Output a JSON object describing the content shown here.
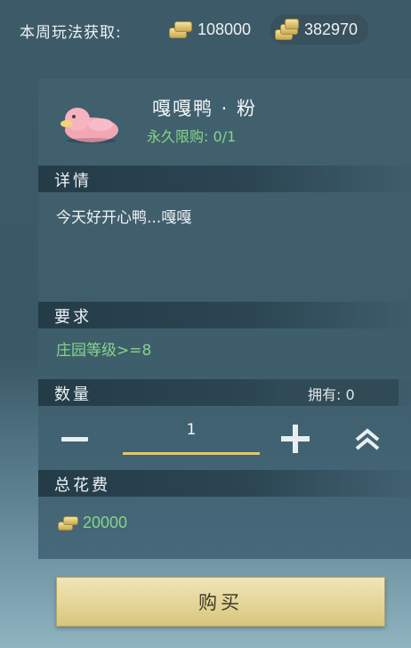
{
  "top": {
    "week_label": "本周玩法获取:",
    "currency_1": {
      "icon": "gold-ingot-icon",
      "value": "108000"
    },
    "currency_2": {
      "icon": "gold-ingot-stack-icon",
      "value": "382970"
    }
  },
  "item": {
    "icon": "pink-duck-icon",
    "name": "嘎嘎鸭 · 粉",
    "limit": "永久限购: 0/1"
  },
  "details": {
    "title": "详情",
    "text": "今天好开心鸭...嘎嘎"
  },
  "requirement": {
    "title": "要求",
    "text": "庄园等级>=8"
  },
  "quantity": {
    "title": "数量",
    "owned": "拥有: 0",
    "value": "1"
  },
  "total": {
    "title": "总花费",
    "icon": "gold-ingot-icon",
    "value": "20000"
  },
  "buy_label": "购买",
  "colors": {
    "accent_green": "#86d48a",
    "gold": "#e5c85a",
    "panel": "#3e5e6c"
  }
}
